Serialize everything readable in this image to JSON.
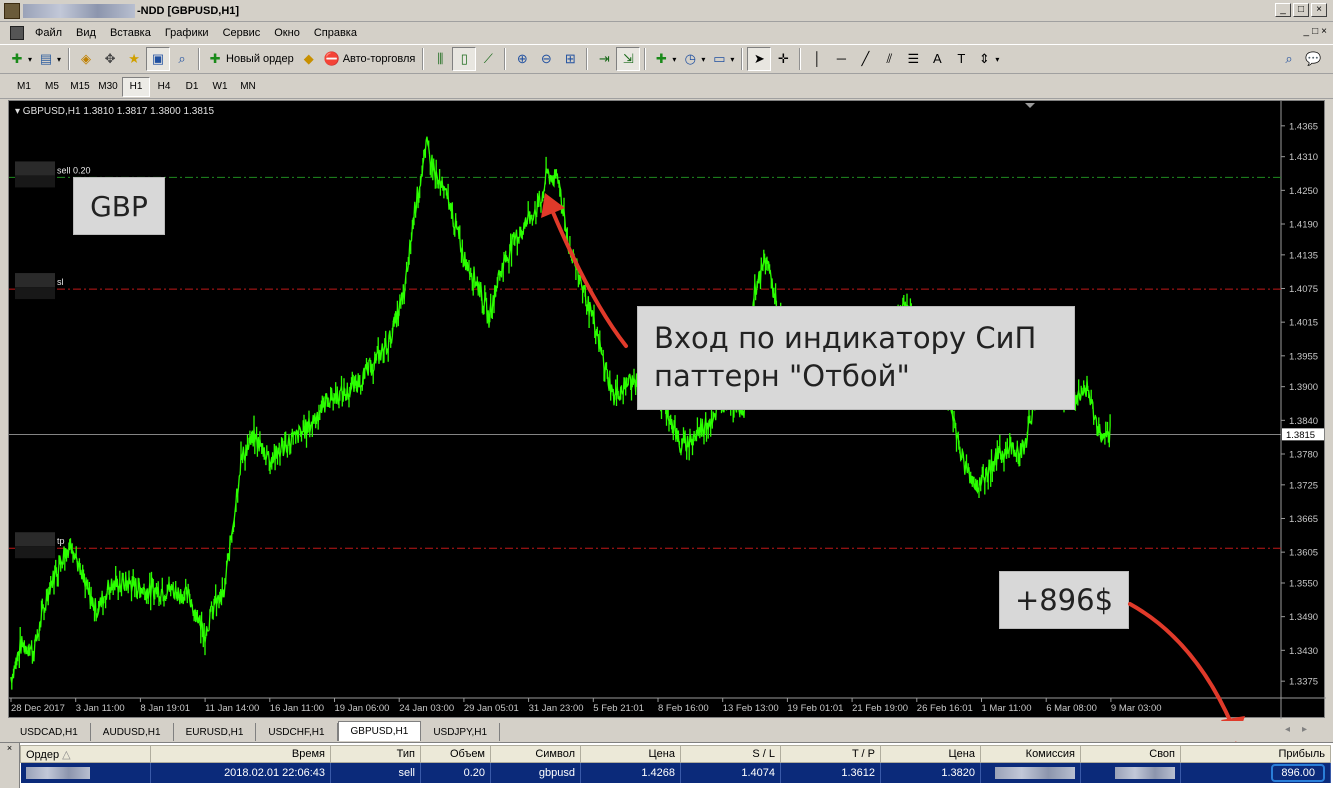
{
  "window": {
    "title": "-NDD  [GBPUSD,H1]",
    "min": "_",
    "restore": "□",
    "close": "×"
  },
  "menu": [
    "Файл",
    "Вид",
    "Вставка",
    "Графики",
    "Сервис",
    "Окно",
    "Справка"
  ],
  "menu_right": {
    "min": "_",
    "restore": "□",
    "close": "×"
  },
  "toolbar": {
    "new_order": "Новый ордер",
    "auto_trading": "Авто-торговля"
  },
  "timeframes": [
    "M1",
    "M5",
    "M15",
    "M30",
    "H1",
    "H4",
    "D1",
    "W1",
    "MN"
  ],
  "timeframe_active": "H1",
  "chart": {
    "header": "GBPUSD,H1  1.3810 1.3817 1.3800 1.3815",
    "current_price": "1.3815",
    "price_labels": [
      "1.4365",
      "1.4310",
      "1.4250",
      "1.4190",
      "1.4135",
      "1.4075",
      "1.4015",
      "1.3955",
      "1.3900",
      "1.3840",
      "1.3780",
      "1.3725",
      "1.3665",
      "1.3605",
      "1.3550",
      "1.3490",
      "1.3430",
      "1.3375"
    ],
    "time_labels": [
      "28 Dec 2017",
      "3 Jan 11:00",
      "8 Jan 19:01",
      "11 Jan 14:00",
      "16 Jan 11:00",
      "19 Jan 06:00",
      "24 Jan 03:00",
      "29 Jan 05:01",
      "31 Jan 23:00",
      "5 Feb 21:01",
      "8 Feb 16:00",
      "13 Feb 13:00",
      "19 Feb 01:01",
      "21 Feb 19:00",
      "26 Feb 16:01",
      "1 Mar 11:00",
      "6 Mar 08:00",
      "9 Mar 03:00"
    ],
    "lines": [
      {
        "label": "sell 0.20",
        "price": 1.4273,
        "color": "#1f8a1f"
      },
      {
        "label": "sl",
        "price": 1.4074,
        "color": "#c01818"
      },
      {
        "label": "tp",
        "price": 1.3612,
        "color": "#c01818"
      }
    ],
    "y_min": 1.3345,
    "y_max": 1.4395,
    "line_color": "#2bff00",
    "price_colors": {
      "background": "#000000",
      "axis_text": "#c8c8c8"
    }
  },
  "annotations": {
    "gbp": "GBP",
    "entry": [
      "Вход по индикатору СиП",
      "паттерн \"Отбой\""
    ],
    "profit": "+896$",
    "arrow_color": "#e03a2a"
  },
  "symbol_tabs": [
    "USDCAD,H1",
    "AUDUSD,H1",
    "EURUSD,H1",
    "USDCHF,H1",
    "GBPUSD,H1",
    "USDJPY,H1"
  ],
  "symbol_tab_active": "GBPUSD,H1",
  "orders": {
    "headers": [
      "Ордер",
      "Время",
      "Тип",
      "Объем",
      "Символ",
      "Цена",
      "S / L",
      "T / P",
      "Цена",
      "Комиссия",
      "Своп",
      "Прибыль"
    ],
    "row": {
      "time": "2018.02.01 22:06:43",
      "type": "sell",
      "volume": "0.20",
      "symbol": "gbpusd",
      "open_price": "1.4268",
      "sl": "1.4074",
      "tp": "1.3612",
      "price": "1.3820",
      "profit": "896.00"
    }
  }
}
